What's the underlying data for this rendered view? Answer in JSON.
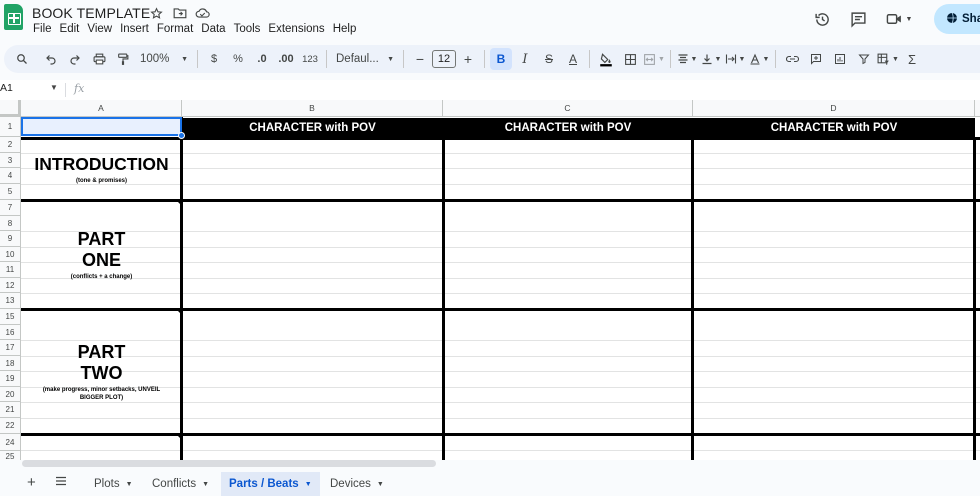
{
  "app": {
    "title": "BOOK TEMPLATE",
    "share_label": "Sha"
  },
  "menu": [
    "File",
    "Edit",
    "View",
    "Insert",
    "Format",
    "Data",
    "Tools",
    "Extensions",
    "Help"
  ],
  "toolbar": {
    "zoom": "100%",
    "currency": "$",
    "percent": "%",
    "dec_decrease": ".0",
    "dec_increase": ".00",
    "number_format": "123",
    "font": "Defaul...",
    "font_size": "12",
    "minus": "−",
    "plus": "+",
    "bold": "B",
    "italic": "I",
    "strike": "S",
    "text_color": "A",
    "sigma": "Σ"
  },
  "formula_bar": {
    "cell_ref": "A1",
    "fx": "fx"
  },
  "columns": [
    "A",
    "B",
    "C",
    "D"
  ],
  "rows": [
    "1",
    "2",
    "3",
    "4",
    "5",
    "7",
    "8",
    "9",
    "10",
    "11",
    "12",
    "13",
    "15",
    "16",
    "17",
    "18",
    "19",
    "20",
    "21",
    "22",
    "24",
    "25"
  ],
  "header_row": [
    "CHARACTER with POV",
    "CHARACTER with POV",
    "CHARACTER with POV"
  ],
  "sections": [
    {
      "title_lines": [
        "INTRODUCTION"
      ],
      "subtitle": "(tone & promises)"
    },
    {
      "title_lines": [
        "PART",
        "ONE"
      ],
      "subtitle": "(conflicts + a change)"
    },
    {
      "title_lines": [
        "PART",
        "TWO"
      ],
      "subtitle": "(make progress, minor setbacks, UNVEIL BIGGER PLOT)"
    }
  ],
  "sheet_tabs": [
    {
      "label": "Plots",
      "active": false
    },
    {
      "label": "Conflicts",
      "active": false
    },
    {
      "label": "Parts / Beats",
      "active": true
    },
    {
      "label": "Devices",
      "active": false
    }
  ],
  "colors": {
    "accent": "#0b57d0",
    "header_bg": "#000000",
    "sheets_green": "#21a366",
    "share_bg": "#c2e7ff"
  }
}
